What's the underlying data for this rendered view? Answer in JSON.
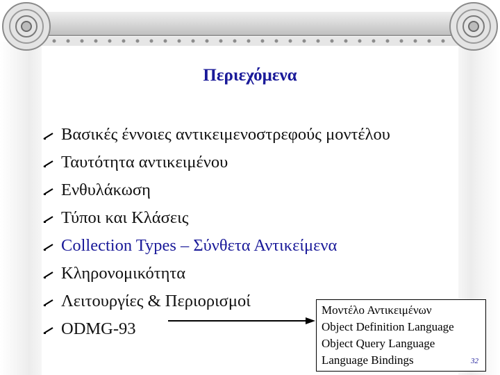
{
  "slide": {
    "title": "Περιεχόμενα",
    "bullets": [
      "Βασικές έννοιες αντικειμενοστρεφούς μοντέλου",
      "Ταυτότητα αντικειμένου",
      "Ενθυλάκωση",
      "Τύποι και Κλάσεις",
      "Collection Types – Σύνθετα Αντικείμενα",
      "Κληρονομικότητα",
      "Λειτουργίες & Περιορισμοί",
      "ODMG-93"
    ],
    "highlight_index": 4,
    "box": {
      "lines": [
        "Μοντέλο Αντικειμένων",
        "Object Definition Language",
        "Object Query Language",
        "Language Bindings"
      ],
      "page_number": "32"
    }
  },
  "colors": {
    "title": "#1a1a99",
    "highlight": "#1a1a99",
    "text": "#111111"
  },
  "icons": {
    "bullet": "pen-bullet-icon",
    "volute": "volute-scroll-icon"
  }
}
